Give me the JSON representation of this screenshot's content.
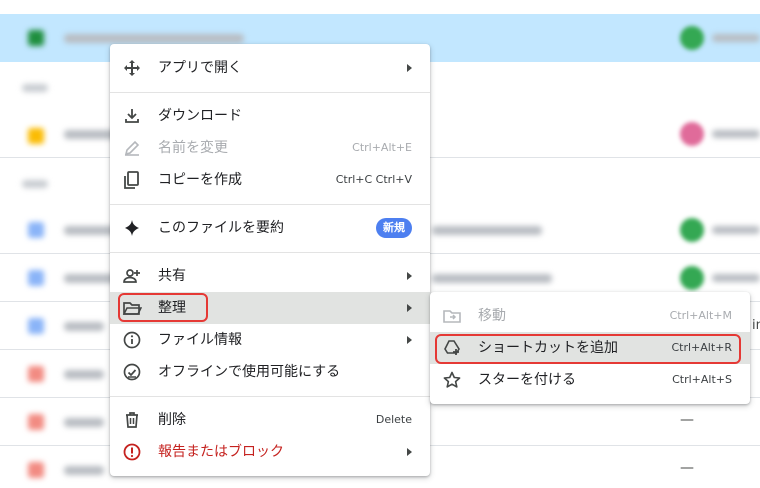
{
  "background": {
    "tail_mark": "in",
    "dash": "—"
  },
  "menu": {
    "items": [
      {
        "label": "アプリで開く",
        "has_submenu": true,
        "icon": "move-arrows-icon"
      },
      {
        "label": "ダウンロード",
        "icon": "download-icon"
      },
      {
        "label": "名前を変更",
        "shortcut": "Ctrl+Alt+E",
        "disabled": true,
        "icon": "pencil-icon"
      },
      {
        "label": "コピーを作成",
        "shortcut": "Ctrl+C Ctrl+V",
        "icon": "copy-icon"
      },
      {
        "label": "このファイルを要約",
        "badge": "新規",
        "icon": "sparkle-icon"
      },
      {
        "label": "共有",
        "has_submenu": true,
        "icon": "person-add-icon"
      },
      {
        "label": "整理",
        "has_submenu": true,
        "icon": "folder-open-icon",
        "highlighted": true
      },
      {
        "label": "ファイル情報",
        "has_submenu": true,
        "icon": "info-icon"
      },
      {
        "label": "オフラインで使用可能にする",
        "icon": "offline-check-icon"
      },
      {
        "label": "削除",
        "shortcut": "Delete",
        "icon": "trash-icon"
      },
      {
        "label": "報告またはブロック",
        "has_submenu": true,
        "icon": "report-icon",
        "danger": true
      }
    ]
  },
  "submenu": {
    "items": [
      {
        "label": "移動",
        "shortcut": "Ctrl+Alt+M",
        "disabled": true,
        "icon": "move-to-folder-icon"
      },
      {
        "label": "ショートカットを追加",
        "shortcut": "Ctrl+Alt+R",
        "icon": "add-shortcut-icon",
        "highlighted": true
      },
      {
        "label": "スターを付ける",
        "shortcut": "Ctrl+Alt+S",
        "icon": "star-icon"
      }
    ]
  },
  "colors": {
    "selected_row": "#c2e7ff",
    "hover": "#e1e3e1",
    "badge": "#4d7ff0",
    "danger": "#c5221f",
    "highlight_box": "#e53935"
  }
}
